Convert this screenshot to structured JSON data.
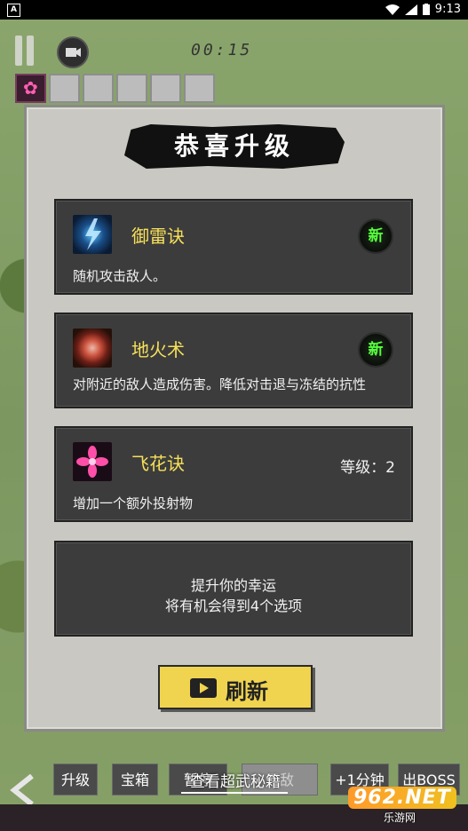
{
  "status_bar": {
    "time": "9:13",
    "notification_icon": "A"
  },
  "hud": {
    "timer": "00:15"
  },
  "modal": {
    "title": "恭喜升级",
    "cards": [
      {
        "name": "御雷诀",
        "desc": "随机攻击敌人。",
        "badge": "新",
        "icon": "thunder-icon"
      },
      {
        "name": "地火术",
        "desc": "对附近的敌人造成伤害。降低对击退与冻结的抗性",
        "badge": "新",
        "icon": "fire-circle-icon"
      },
      {
        "name": "飞花诀",
        "desc": "增加一个额外投射物",
        "level": "等级：2",
        "icon": "flower-icon"
      }
    ],
    "luck": {
      "line1": "提升你的幸运",
      "line2": "将有机会得到4个选项"
    },
    "refresh_label": "刷新"
  },
  "bottom_bar": {
    "buttons": [
      "升级",
      "宝箱",
      "暂停",
      "无敌",
      "+1分钟",
      "出BOSS"
    ],
    "cheat_link": "查看超武秘籍"
  },
  "watermark": {
    "logo": "962.NET",
    "sub": "乐游网"
  }
}
